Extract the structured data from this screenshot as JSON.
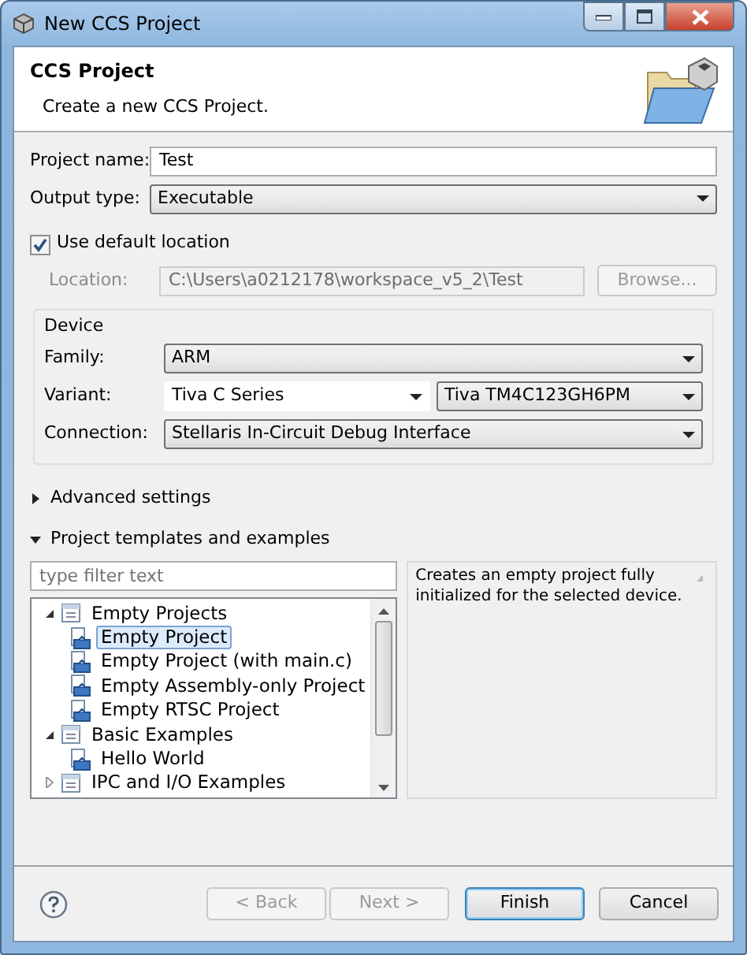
{
  "window": {
    "title": "New CCS Project"
  },
  "header": {
    "title": "CCS Project",
    "subtitle": "Create a new CCS Project."
  },
  "project_name": {
    "label": "Project name:",
    "value": "Test"
  },
  "output_type": {
    "label": "Output type:",
    "value": "Executable"
  },
  "default_location": {
    "label": "Use default location",
    "checked": true
  },
  "location": {
    "label": "Location:",
    "value": "C:\\Users\\a0212178\\workspace_v5_2\\Test",
    "disabled": true,
    "button": "Browse..."
  },
  "device": {
    "title": "Device",
    "family": {
      "label": "Family:",
      "value": "ARM"
    },
    "variant": {
      "label": "Variant:",
      "value": "Tiva C Series",
      "value_2": "Tiva TM4C123GH6PM"
    },
    "connection": {
      "label": "Connection:",
      "value": "Stellaris In-Circuit Debug Interface"
    }
  },
  "sections": [
    {
      "label": "Advanced settings",
      "expanded": false
    },
    {
      "label": "Project templates and examples",
      "expanded": true
    }
  ],
  "filter": {
    "placeholder": "type filter text"
  },
  "tree": [
    {
      "label": "Empty Projects",
      "expanded": true,
      "selected": false,
      "children": [
        {
          "label": "Empty Project",
          "selected": true
        },
        {
          "label": "Empty Project (with main.c)",
          "selected": false
        },
        {
          "label": "Empty Assembly-only Project",
          "selected": false
        },
        {
          "label": "Empty RTSC Project",
          "selected": false
        }
      ]
    },
    {
      "label": "Basic Examples",
      "expanded": true,
      "selected": false,
      "children": [
        {
          "label": "Hello World",
          "selected": false
        }
      ]
    },
    {
      "label": "IPC and I/O Examples",
      "expanded": false,
      "selected": false
    }
  ],
  "description": "Creates an empty project fully initialized for the selected device.",
  "buttons": [
    {
      "label": "< Back",
      "disabled": true,
      "default": false
    },
    {
      "label": "Next >",
      "disabled": true,
      "default": false
    },
    {
      "label": "Finish",
      "disabled": false,
      "default": true
    },
    {
      "label": "Cancel",
      "disabled": false,
      "default": false
    }
  ]
}
